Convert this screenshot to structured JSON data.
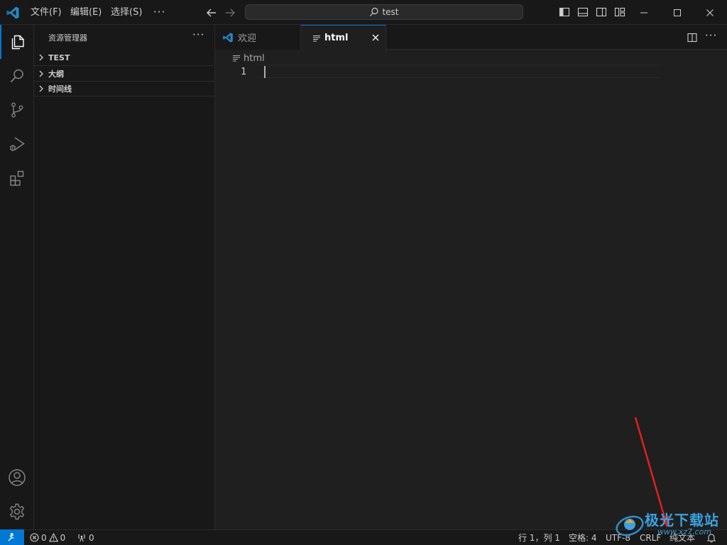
{
  "titlebar": {
    "menus": {
      "file": "文件(F)",
      "edit": "编辑(E)",
      "select": "选择(S)",
      "more": "···"
    },
    "command_center": "test",
    "icons": {
      "logo": "vscode-logo-icon",
      "back": "arrow-left-icon",
      "forward": "arrow-right-icon",
      "search": "search-icon",
      "toggle_sidebar": "layout-sidebar-icon",
      "toggle_panel": "layout-panel-icon",
      "toggle_secondary": "layout-secondary-sidebar-icon",
      "customize_layout": "customize-layout-icon",
      "minimize": "minimize-icon",
      "maximize": "maximize-icon",
      "close": "close-icon"
    }
  },
  "activitybar": {
    "items": [
      "files-icon",
      "search-icon",
      "source-control-icon",
      "run-debug-icon",
      "extensions-icon"
    ],
    "bottom": [
      "account-icon",
      "gear-icon"
    ],
    "active": "files-icon"
  },
  "sidebar": {
    "title": "资源管理器",
    "more": "···",
    "sections": {
      "test": "TEST",
      "outline": "大纲",
      "timeline": "时间线"
    }
  },
  "editor": {
    "tabs": {
      "welcome": "欢迎",
      "html": "html"
    },
    "active_tab": "html",
    "more": "···",
    "breadcrumb": "html",
    "lines": [
      "1"
    ]
  },
  "statusbar": {
    "errors": "0",
    "warnings": "0",
    "ports": "0",
    "position": "行 1，列 1",
    "indent": "空格: 4",
    "encoding": "UTF-8",
    "eol": "CRLF",
    "language": "纯文本"
  },
  "watermark": {
    "title": "极光下载站",
    "url": "www.xz7.com"
  },
  "colors": {
    "accent": "#0078d4",
    "background": "#1f1f1f",
    "chrome": "#181818",
    "annotation": "#e02020",
    "watermark": "#3aa2e0"
  }
}
